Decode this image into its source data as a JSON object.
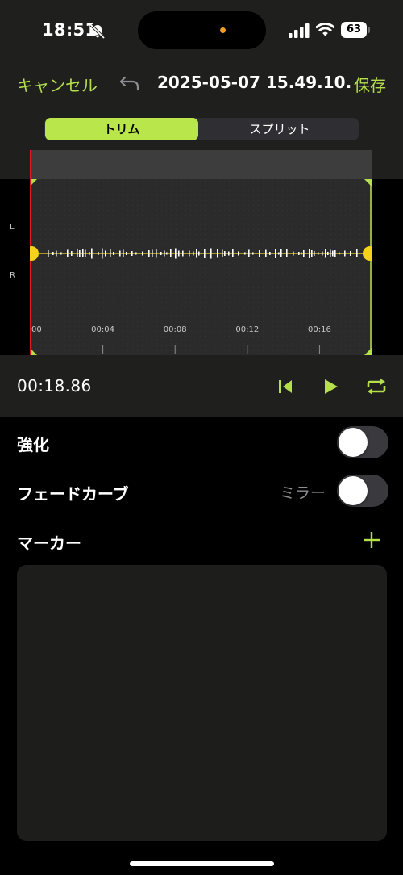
{
  "status_bar": {
    "time": "18:51",
    "battery": "63",
    "icons": [
      "bell-slash-icon",
      "cellular-signal-icon",
      "wifi-icon",
      "battery-icon"
    ]
  },
  "nav": {
    "cancel_label": "キャンセル",
    "title": "2025-05-07 15.49.10...",
    "save_label": "保存",
    "undo_icon": "undo-icon"
  },
  "segmented": {
    "trim_label": "トリム",
    "split_label": "スプリット",
    "selected": "trim"
  },
  "waveform": {
    "left_channel_label": "L",
    "right_channel_label": "R",
    "time_labels": [
      "00",
      "00:04",
      "00:08",
      "00:12",
      "00:16"
    ],
    "total_seconds": 18.86,
    "playhead_seconds": 0,
    "trim_start_seconds": 0,
    "trim_end_seconds": 18.86
  },
  "playback": {
    "duration": "00:18.86",
    "icons": [
      "skip-to-start-icon",
      "play-icon",
      "repeat-icon"
    ]
  },
  "settings": {
    "enhance_label": "強化",
    "enhance_on": false,
    "fade_curve_label": "フェードカーブ",
    "fade_curve_value": "ミラー",
    "fade_curve_on": false,
    "markers_label": "マーカー",
    "add_marker_icon": "plus-icon"
  },
  "colors": {
    "accent": "#b5e04b",
    "playhead": "#e01b24",
    "handle": "#f5d21c",
    "bar_background": "#1f1f1d"
  }
}
